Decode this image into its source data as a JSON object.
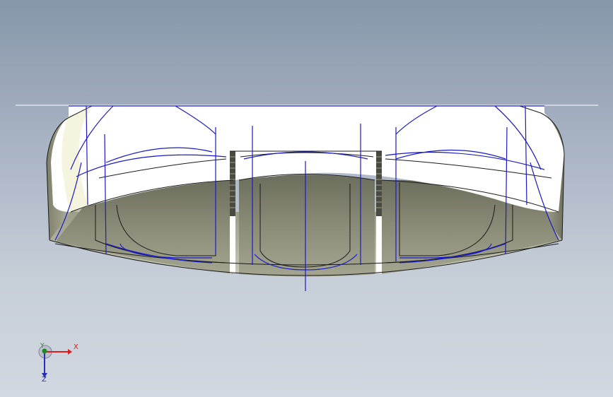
{
  "viewport": {
    "background_top": "#8796aa",
    "background_bottom": "#d2d8e0"
  },
  "model": {
    "shell_color": "#ffffff",
    "pocket_color": "#8d8f7c",
    "edge_color": "#1a1a1a",
    "sketch_color": "#1a1ac8"
  },
  "triad": {
    "x_label": "X",
    "y_label": "Y",
    "z_label": "Z",
    "x_color": "#d42020",
    "y_color": "#1f8a1f",
    "z_color": "#2530b8"
  }
}
